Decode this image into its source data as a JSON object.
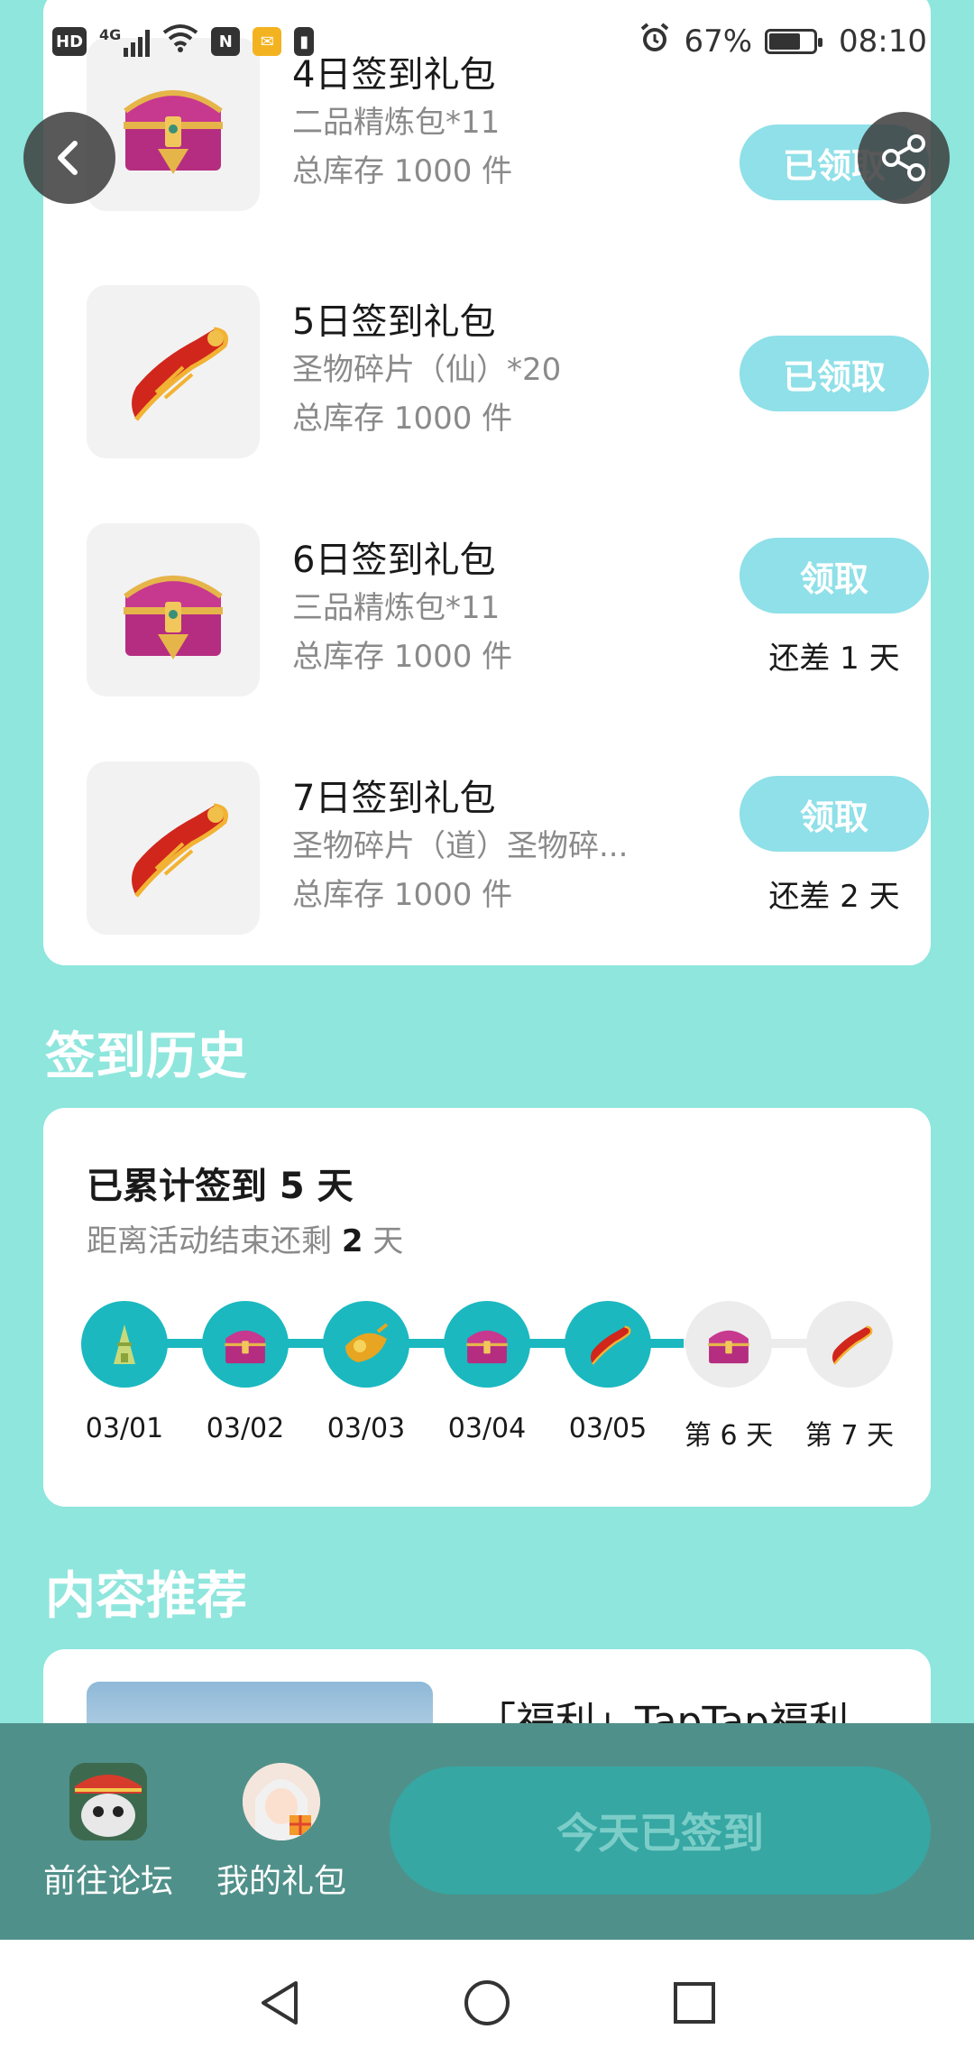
{
  "status_bar": {
    "left_icons": [
      "hd-icon",
      "signal-4g-icon",
      "wifi-icon",
      "nfc-icon",
      "mail-icon",
      "battery-saver-icon"
    ],
    "hd_label": "HD",
    "network_label": "4G",
    "nfc_label": "N",
    "battery_percent": "67%",
    "time": "08:10"
  },
  "gift_list": {
    "items": [
      {
        "title": "4日签到礼包",
        "desc": "二品精炼包*11",
        "stock": "总库存 1000 件",
        "button": "已领取",
        "remain": "",
        "icon": "treasure-chest-icon"
      },
      {
        "title": "5日签到礼包",
        "desc": "圣物碎片（仙）*20",
        "stock": "总库存 1000 件",
        "button": "已领取",
        "remain": "",
        "icon": "relic-shard-icon"
      },
      {
        "title": "6日签到礼包",
        "desc": "三品精炼包*11",
        "stock": "总库存 1000 件",
        "button": "领取",
        "remain": "还差 1 天",
        "icon": "treasure-chest-icon"
      },
      {
        "title": "7日签到礼包",
        "desc": "圣物碎片（道）圣物碎...",
        "stock": "总库存 1000 件",
        "button": "领取",
        "remain": "还差 2 天",
        "icon": "relic-shard-icon"
      }
    ]
  },
  "history": {
    "heading": "签到历史",
    "total_text": "已累计签到 5 天",
    "remain_prefix": "距离活动结束还剩",
    "remain_days": "2",
    "remain_suffix": "天",
    "days": [
      {
        "label": "03/01",
        "done": true
      },
      {
        "label": "03/02",
        "done": true
      },
      {
        "label": "03/03",
        "done": true
      },
      {
        "label": "03/04",
        "done": true
      },
      {
        "label": "03/05",
        "done": true
      },
      {
        "label": "第 6 天",
        "done": false
      },
      {
        "label": "第 7 天",
        "done": false
      }
    ]
  },
  "recommend": {
    "heading": "内容推荐",
    "first_title": "「福利」TapTap福利"
  },
  "action_bar": {
    "forum_label": "前往论坛",
    "gifts_label": "我的礼包",
    "checkin_label": "今天已签到"
  },
  "colors": {
    "background": "#8ee6dd",
    "accent": "#1bb8c0",
    "claimed_button": "#8fe0e8",
    "action_bar": "#50908a"
  }
}
